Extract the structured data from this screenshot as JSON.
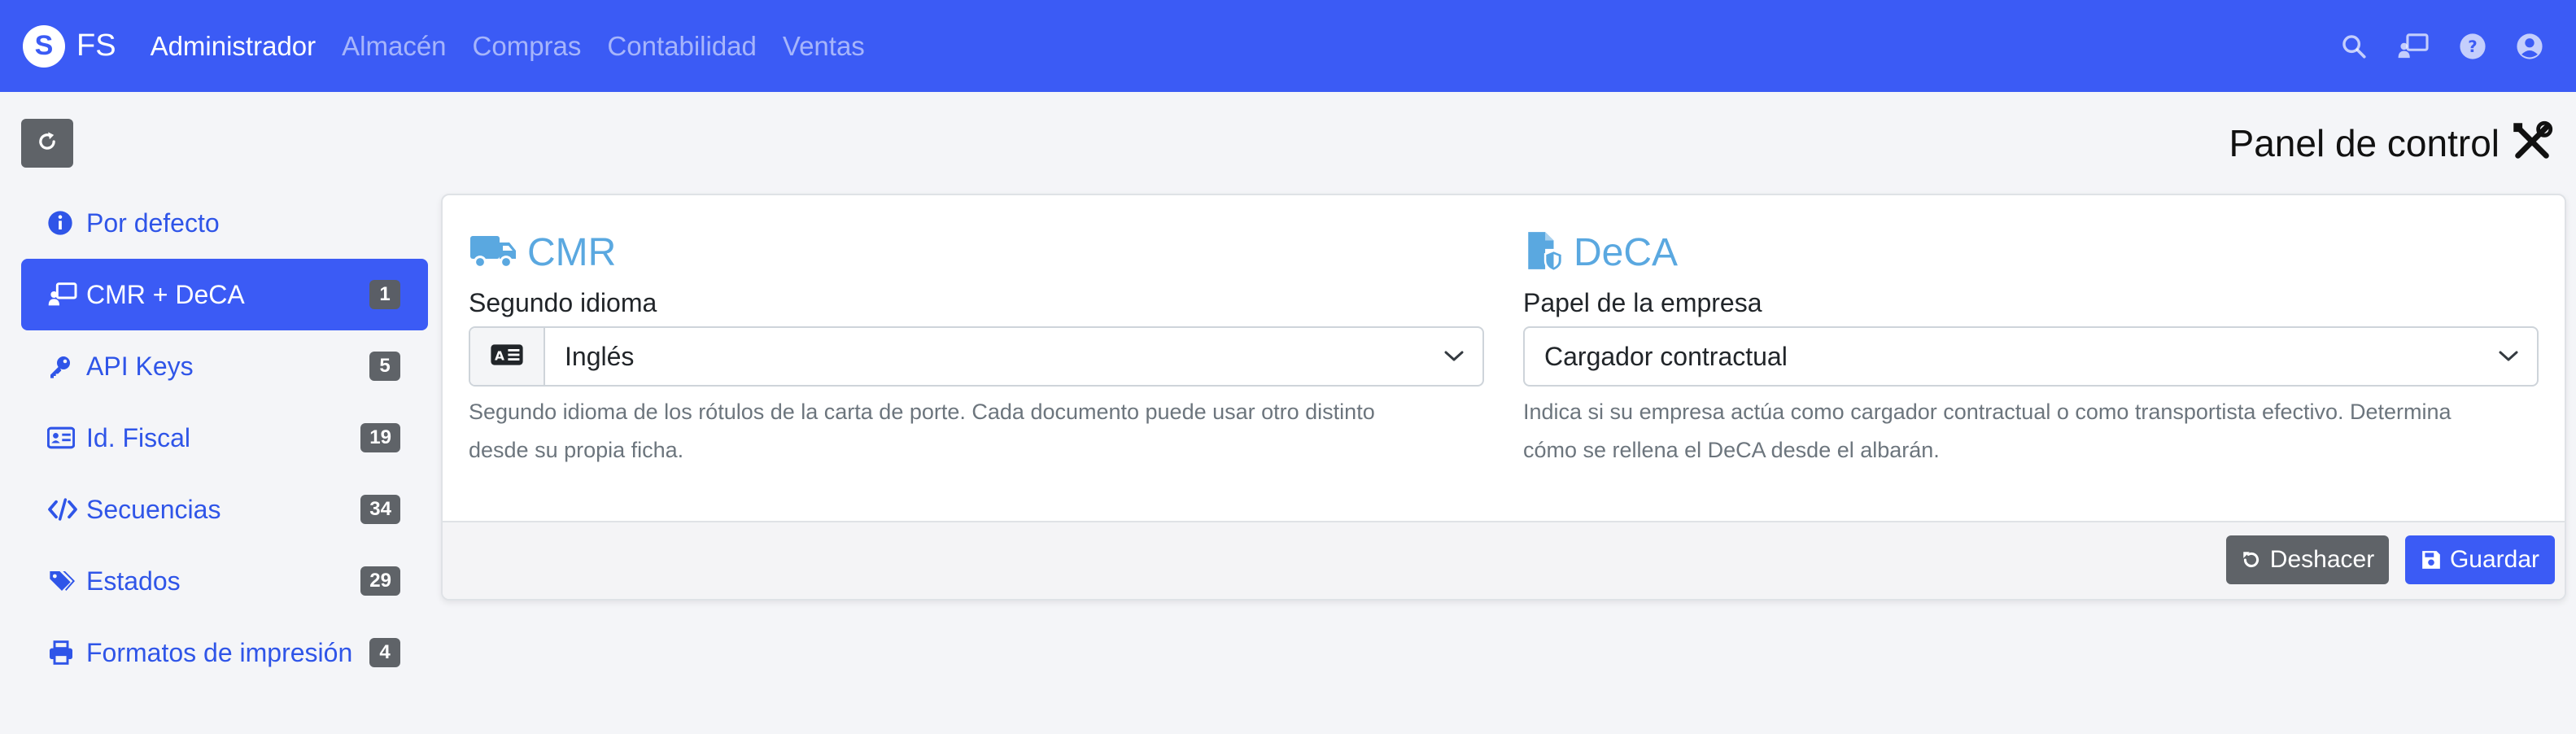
{
  "brand": {
    "logo_letter": "S",
    "name": "FS"
  },
  "nav": {
    "items": [
      {
        "label": "Administrador",
        "active": true
      },
      {
        "label": "Almacén",
        "active": false
      },
      {
        "label": "Compras",
        "active": false
      },
      {
        "label": "Contabilidad",
        "active": false
      },
      {
        "label": "Ventas",
        "active": false
      }
    ],
    "icons": [
      "search-icon",
      "screen-user-icon",
      "help-icon",
      "user-icon"
    ]
  },
  "page": {
    "title": "Panel de control",
    "title_icon": "tools-icon"
  },
  "sidebar": {
    "items": [
      {
        "label": "Por defecto",
        "icon": "info-icon",
        "badge": ""
      },
      {
        "label": "CMR + DeCA",
        "icon": "screen-user-icon",
        "badge": "1",
        "active": true
      },
      {
        "label": "API Keys",
        "icon": "key-icon",
        "badge": "5"
      },
      {
        "label": "Id. Fiscal",
        "icon": "id-card-icon",
        "badge": "19"
      },
      {
        "label": "Secuencias",
        "icon": "code-icon",
        "badge": "34"
      },
      {
        "label": "Estados",
        "icon": "tags-icon",
        "badge": "29"
      },
      {
        "label": "Formatos de impresión",
        "icon": "printer-icon",
        "badge": "4"
      }
    ]
  },
  "cmr": {
    "title": "CMR",
    "icon": "truck-icon",
    "field_label": "Segundo idioma",
    "prefix_icon": "language-icon",
    "value": "Inglés",
    "help_line1": "Segundo idioma de los rótulos de la carta de porte. Cada documento puede usar otro distinto",
    "help_line2": "desde su propia ficha."
  },
  "deca": {
    "title": "DeCA",
    "icon": "file-shield-icon",
    "field_label": "Papel de la empresa",
    "value": "Cargador contractual",
    "help_line1": "Indica si su empresa actúa como cargador contractual o como transportista efectivo. Determina",
    "help_line2": "cómo se rellena el DeCA desde el albarán."
  },
  "footer": {
    "undo_label": "Deshacer",
    "save_label": "Guardar"
  },
  "colors": {
    "primary": "#3b5bf5",
    "secondary": "#5f6368",
    "accent_title": "#5aa8e0",
    "link": "#2f55e8"
  }
}
